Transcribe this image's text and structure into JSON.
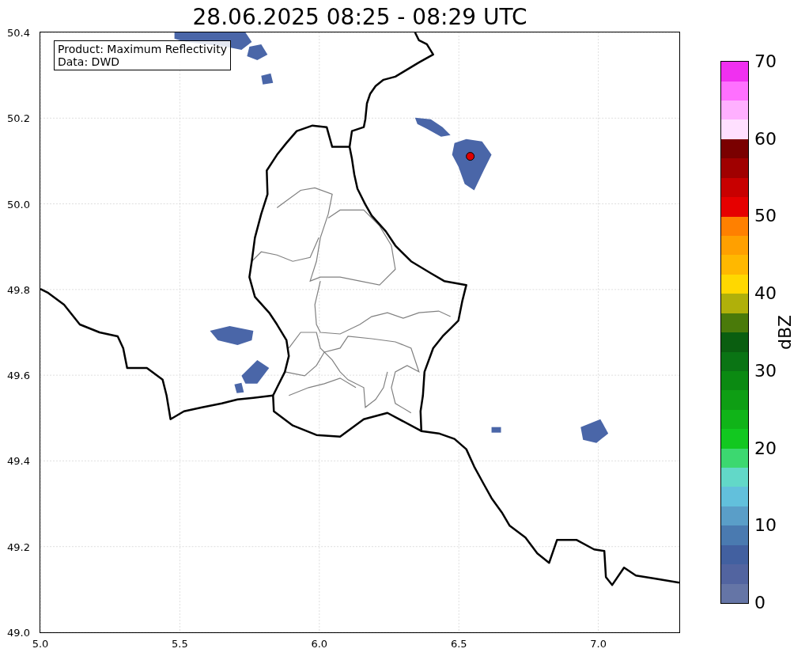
{
  "title": "28.06.2025 08:25 - 08:29 UTC",
  "map": {
    "info_lines": [
      "Product: Maximum Reflectivity",
      "Data: DWD"
    ],
    "xticks": [
      "5.0",
      "5.5",
      "6.0",
      "6.5",
      "7.0"
    ],
    "yticks": [
      "50.4",
      "50.2",
      "50.0",
      "49.8",
      "49.6",
      "49.4",
      "49.2",
      "49.0"
    ]
  },
  "colorbar": {
    "label": "dBZ",
    "ticks": [
      "70",
      "60",
      "50",
      "40",
      "30",
      "20",
      "10",
      "0"
    ],
    "segments": [
      {
        "color": "#6575a6"
      },
      {
        "color": "#5264a0"
      },
      {
        "color": "#4260a0"
      },
      {
        "color": "#4a7ab0"
      },
      {
        "color": "#5a9ec8"
      },
      {
        "color": "#62c0dc"
      },
      {
        "color": "#62d8c8"
      },
      {
        "color": "#3cd870"
      },
      {
        "color": "#12c820"
      },
      {
        "color": "#10b418"
      },
      {
        "color": "#0e9e14"
      },
      {
        "color": "#0b8a12"
      },
      {
        "color": "#0a7414"
      },
      {
        "color": "#0a5e10"
      },
      {
        "color": "#4a7a0a"
      },
      {
        "color": "#b0b00a"
      },
      {
        "color": "#ffd800"
      },
      {
        "color": "#ffb800"
      },
      {
        "color": "#ffa000"
      },
      {
        "color": "#ff8000"
      },
      {
        "color": "#e60000"
      },
      {
        "color": "#c80000"
      },
      {
        "color": "#a00000"
      },
      {
        "color": "#7a0000"
      },
      {
        "color": "#ffe0ff"
      },
      {
        "color": "#ffb0ff"
      },
      {
        "color": "#ff70ff"
      },
      {
        "color": "#f030f0"
      }
    ]
  }
}
